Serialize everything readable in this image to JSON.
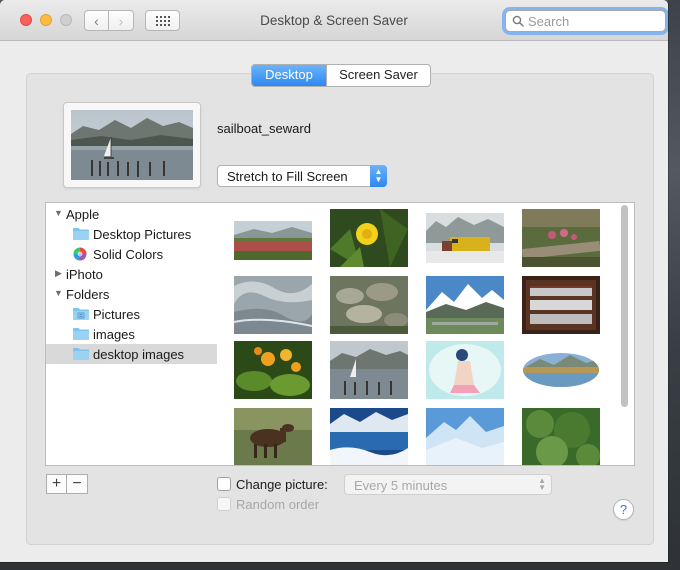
{
  "window": {
    "title": "Desktop & Screen Saver",
    "search": {
      "placeholder": "Search",
      "value": ""
    }
  },
  "tabs": [
    {
      "label": "Desktop",
      "selected": true
    },
    {
      "label": "Screen Saver",
      "selected": false
    }
  ],
  "preview": {
    "picture_name": "sailboat_seward",
    "fit_option": "Stretch to Fill Screen"
  },
  "sidebar": {
    "items": [
      {
        "label": "Apple",
        "kind": "group",
        "expanded": true
      },
      {
        "label": "Desktop Pictures",
        "kind": "folder-icon"
      },
      {
        "label": "Solid Colors",
        "kind": "color-wheel-icon"
      },
      {
        "label": "iPhoto",
        "kind": "group",
        "expanded": false
      },
      {
        "label": "Folders",
        "kind": "group",
        "expanded": true
      },
      {
        "label": "Pictures",
        "kind": "pictures-folder-icon"
      },
      {
        "label": "images",
        "kind": "folder-icon"
      },
      {
        "label": "desktop images",
        "kind": "folder-icon",
        "selected": true
      }
    ]
  },
  "thumbnails": [
    "wildflower-meadow",
    "dandelion",
    "yellow-train",
    "wildflower-logs",
    "glacier-ice",
    "rocky-stream",
    "snowy-mountains",
    "silverware-box",
    "yellow-flowers",
    "sailboat-harbor",
    "anime-girl",
    "oval-mountain-lake",
    "moose",
    "blue-glacier-lake",
    "blue-ice",
    "green-spruce"
  ],
  "controls": {
    "add_label": "+",
    "remove_label": "−",
    "change_picture_label": "Change picture:",
    "change_picture_checked": false,
    "interval_value": "Every 5 minutes",
    "random_order_label": "Random order",
    "random_order_checked": false,
    "help_label": "?"
  },
  "colors": {
    "accent": "#2c88f0",
    "selection": "#d9d9d9",
    "folder": "#7fc3ef"
  }
}
